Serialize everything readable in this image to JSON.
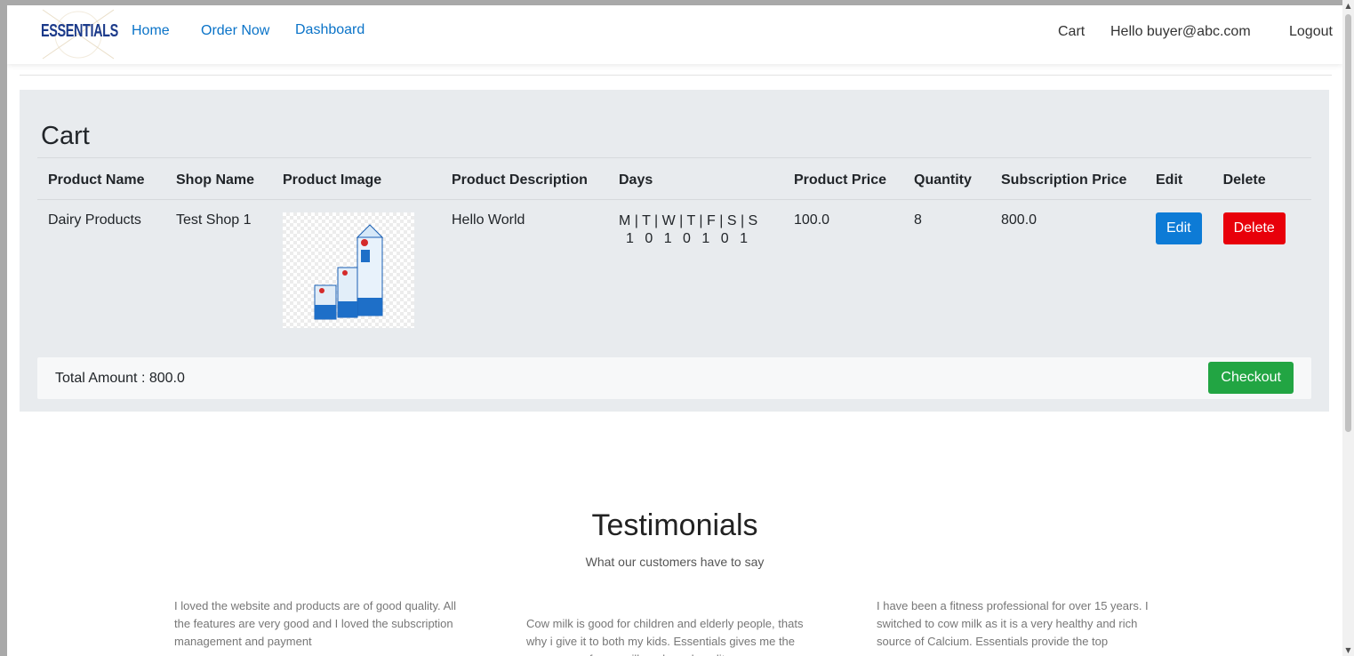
{
  "nav": {
    "logo": "ESSENTIALS",
    "links": [
      "Home",
      "Order Now",
      "Dashboard"
    ],
    "cart": "Cart",
    "greeting": "Hello buyer@abc.com",
    "logout": "Logout",
    "link_color": "#0a73c8"
  },
  "cart": {
    "title": "Cart",
    "headers": [
      "Product Name",
      "Shop Name",
      "Product Image",
      "Product Description",
      "Days",
      "Product Price",
      "Quantity",
      "Subscription Price",
      "Edit",
      "Delete"
    ],
    "rows": [
      {
        "product_name": "Dairy Products",
        "shop_name": "Test Shop 1",
        "description": "Hello World",
        "days_header": "M | T | W | T | F | S | S",
        "days_values": "1 0 1 0 1 0 1",
        "price": "100.0",
        "quantity": "8",
        "subscription_price": "800.0",
        "edit_label": "Edit",
        "delete_label": "Delete"
      }
    ],
    "total": "Total Amount : 800.0",
    "checkout_label": "Checkout",
    "colors": {
      "edit": "#0d7bd6",
      "delete": "#e8000a",
      "checkout": "#22a543"
    }
  },
  "testimonials": {
    "title": "Testimonials",
    "subtitle": "What our customers have to say",
    "items": [
      "I loved the website and products are of good quality. All the features are very good and I loved the subscription management and payment",
      "Cow milk is good for children and elderly people, thats why i give it to both my kids. Essentials gives me the assurance of pure milk and good quality.",
      "I have been a fitness professional for over 15 years. I switched to cow milk as it is a very healthy and rich source of Calcium. Essentials provide the top"
    ]
  }
}
